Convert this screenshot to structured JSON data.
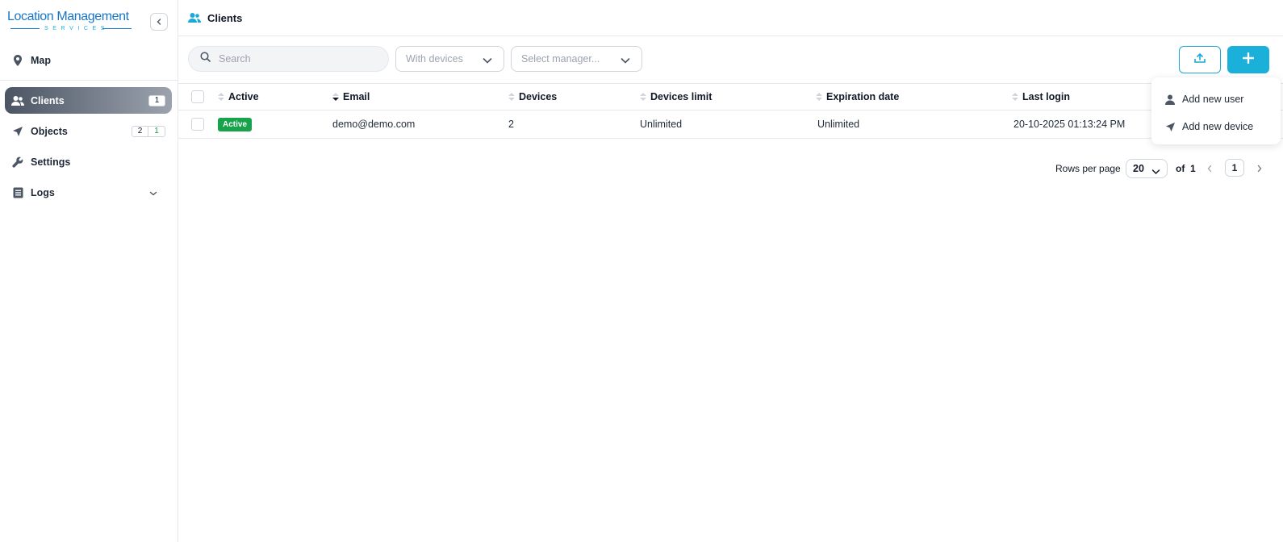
{
  "logo": {
    "title": "Location Management",
    "subtitle": "SERVICES"
  },
  "header": {
    "title": "Clients",
    "icon": "users-icon"
  },
  "sidebar": {
    "items": [
      {
        "label": "Map",
        "icon": "map-pin-icon"
      },
      {
        "label": "Clients",
        "icon": "users-icon",
        "badge": "1",
        "active": true
      },
      {
        "label": "Objects",
        "icon": "navigation-arrow-icon",
        "badge_total": "2",
        "badge_online": "1"
      },
      {
        "label": "Settings",
        "icon": "wrench-icon"
      },
      {
        "label": "Logs",
        "icon": "document-list-icon"
      }
    ]
  },
  "toolbar": {
    "search_placeholder": "Search",
    "devices_filter": "With devices",
    "manager_filter": "Select manager..."
  },
  "table": {
    "columns": [
      "Active",
      "Email",
      "Devices",
      "Devices limit",
      "Expiration date",
      "Last login"
    ],
    "rows": [
      {
        "active": "Active",
        "email": "demo@demo.com",
        "devices": "2",
        "devices_limit": "Unlimited",
        "expiration": "Unlimited",
        "last_login": "20-10-2025 01:13:24 PM"
      }
    ]
  },
  "pagination": {
    "rows_per_page_label": "Rows per page",
    "rows_per_page": "20",
    "of_label": "of",
    "total_pages": "1",
    "current_page": "1"
  },
  "menu": {
    "items": [
      {
        "label": "Add new user",
        "icon": "user-icon"
      },
      {
        "label": "Add new device",
        "icon": "navigation-arrow-icon"
      }
    ]
  },
  "colors": {
    "accent": "#1ab0da",
    "active_status": "#16a34a",
    "brand": "#1776c8"
  }
}
